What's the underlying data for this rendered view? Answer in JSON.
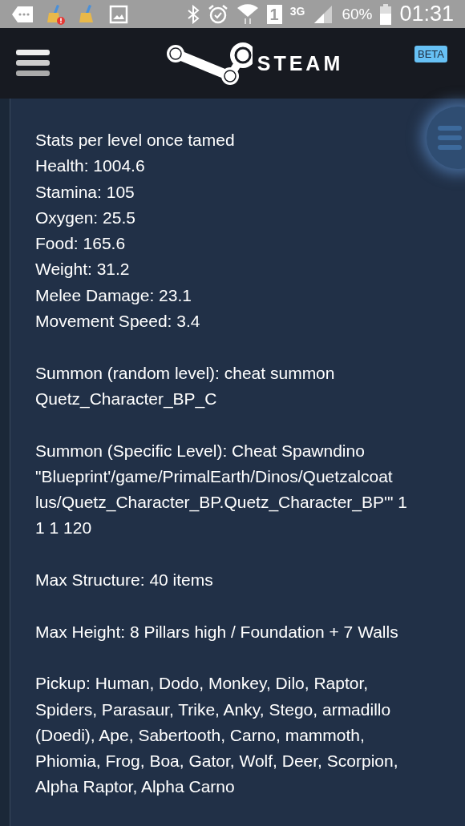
{
  "status_bar": {
    "sim": "1",
    "network": "3G",
    "battery": "60%",
    "time": "01:31"
  },
  "header": {
    "logo": "STEAM",
    "badge": "BETA"
  },
  "paragraphs": [
    {
      "lines": [
        "Stats per level once tamed",
        "Health: 1004.6",
        "Stamina: 105",
        "Oxygen: 25.5",
        "Food: 165.6",
        "Weight: 31.2",
        "Melee Damage: 23.1",
        "Movement Speed: 3.4"
      ]
    },
    {
      "lines": [
        "Summon (random level): cheat summon",
        "Quetz_Character_BP_C"
      ]
    },
    {
      "lines": [
        "Summon (Specific Level): Cheat Spawndino",
        "\"Blueprint'/game/PrimalEarth/Dinos/Quetzalcoat",
        "lus/Quetz_Character_BP.Quetz_Character_BP'\" 1",
        "1 1 120"
      ]
    },
    {
      "lines": [
        "Max Structure: 40 items"
      ]
    },
    {
      "lines": [
        "Max Height: 8 Pillars high / Foundation + 7 Walls"
      ]
    },
    {
      "lines": [
        "Pickup: Human, Dodo, Monkey, Dilo, Raptor,",
        "Spiders, Parasaur, Trike, Anky, Stego, armadillo",
        "(Doedi), Ape, Sabertooth, Carno, mammoth,",
        "Phiomia, Frog, Boa, Gator, Wolf, Deer, Scorpion,",
        "Alpha Raptor, Alpha Carno"
      ]
    }
  ]
}
